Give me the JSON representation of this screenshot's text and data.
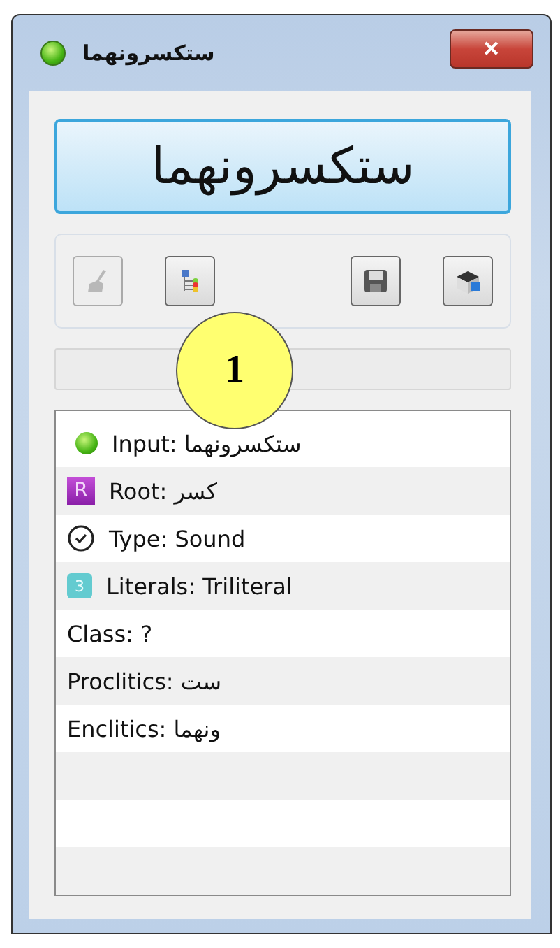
{
  "window": {
    "title": "ستكسرونهما",
    "close": "✕"
  },
  "word_button": {
    "label": "ستكسرونهما"
  },
  "toolbar": [
    {
      "kind": "broom",
      "disabled": true
    },
    {
      "kind": "tree",
      "disabled": false
    },
    {
      "kind": "save",
      "disabled": false
    },
    {
      "kind": "box",
      "disabled": false
    }
  ],
  "results": [
    {
      "kind": "status",
      "text": "Input: ستكسرونهما"
    },
    {
      "kind": "root",
      "text": "Root: كسر",
      "badge": "R"
    },
    {
      "kind": "check",
      "text": "Type: Sound"
    },
    {
      "kind": "count",
      "text": "Literals: Triliteral",
      "badge": "3"
    },
    {
      "kind": "plain",
      "text": "Class: ?"
    },
    {
      "kind": "plain",
      "text": "Proclitics: ست"
    },
    {
      "kind": "plain",
      "text": "Enclitics: ونهما"
    }
  ],
  "callout": {
    "label": "1"
  }
}
